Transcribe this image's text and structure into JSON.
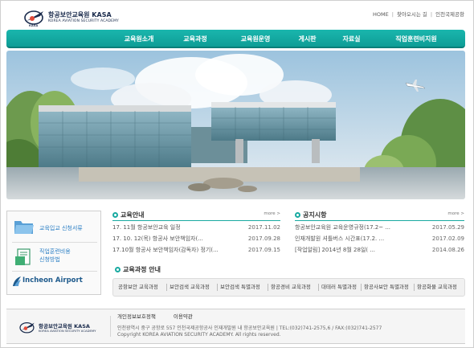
{
  "header": {
    "logo_title": "항공보안교육원 KASA",
    "logo_sub": "KOREA AVIATION SECURITY ACADEMY",
    "logo_mark_text": "KASA",
    "utility": [
      "HOME",
      "찾아오시는 길",
      "인천국제공항"
    ]
  },
  "nav": {
    "items": [
      "교육원소개",
      "교육과정",
      "교육원운영",
      "게시판",
      "자료실",
      "직업훈련비지원"
    ]
  },
  "quick_links": {
    "items": [
      {
        "label_1": "교육입교 신청서류",
        "label_2": "",
        "icon": "folder-icon"
      },
      {
        "label_1": "직업훈련비용",
        "label_2": "신청방법",
        "icon": "document-icon"
      }
    ],
    "airport": "Incheon Airport"
  },
  "news": {
    "title": "교육안내",
    "more": "more >",
    "rows": [
      {
        "text": "17. 11월 항공보안교육 일정",
        "date": "2017.11.02"
      },
      {
        "text": "17. 10. 12(목) 항공사 보안책임자(...",
        "date": "2017.09.28"
      },
      {
        "text": "17.10월 항공사 보안책임자(감독자) 정기(...",
        "date": "2017.09.15"
      }
    ]
  },
  "notice": {
    "title": "공지시항",
    "more": "more >",
    "rows": [
      {
        "text": "항공보안교육원 교육운영규정(17.2~ ...",
        "date": "2017.05.29"
      },
      {
        "text": "인재개발원 셔틀버스 시간표(17.2. ...",
        "date": "2017.02.09"
      },
      {
        "text": "[작업알림] 2014년 8월 28일( ...",
        "date": "2014.08.26"
      }
    ]
  },
  "courses": {
    "title": "교육과정 안내",
    "items": [
      "공항보안 교육과정",
      "보안검색 교육과정",
      "보안검색 특별과정",
      "항공경비 교육과정",
      "대테러 특별과정",
      "항공사보안 특별과정",
      "항공화물 교육과정"
    ]
  },
  "footer": {
    "logo_title": "항공보안교육원 KASA",
    "logo_sub": "KOREA AVIATION SECURITY ACADEMY",
    "links": [
      "개인정보보호정책",
      "이용약관"
    ],
    "address": "인천광역시 중구 공항로 557 인천국제공항공사 인재개발원 내 항공보안교육원  |  TEL:(032)741-2575,6 / FAX:(032)741-2577",
    "copyright": "Copyright KOREA AVIATION SECURITY ACADEMY. All rights reserved."
  },
  "colors": {
    "nav": "#15aca4",
    "accent": "#19aaa1",
    "link_blue": "#2a7ec4",
    "logo_navy": "#1a2b4c"
  }
}
